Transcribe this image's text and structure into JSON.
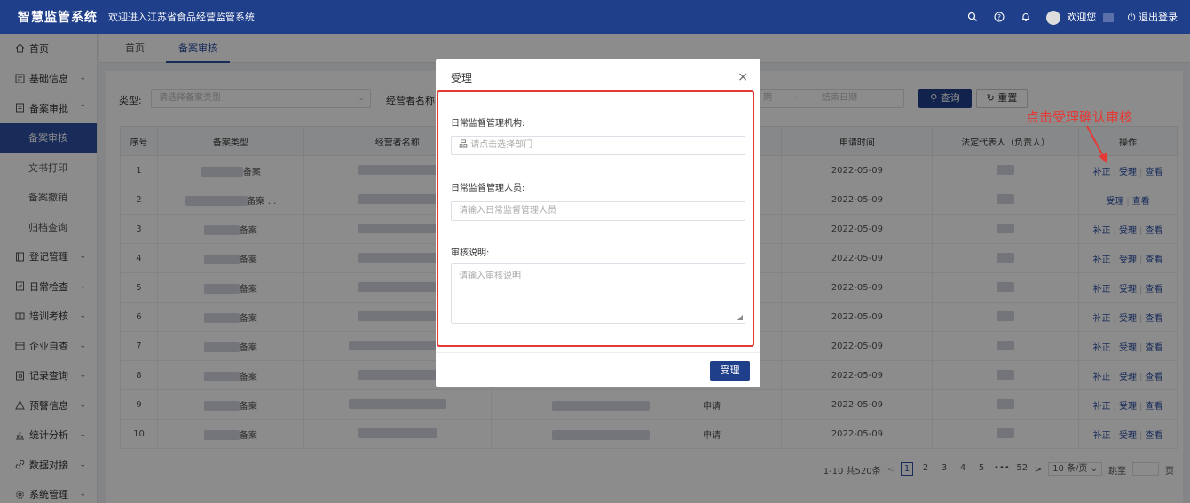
{
  "header": {
    "logo": "智慧监管系统",
    "welcome": "欢迎进入江苏省食品经营监管系统",
    "user_greeting": "欢迎您",
    "logout": "退出登录"
  },
  "sidebar": {
    "items": [
      {
        "label": "首页",
        "icon": "home-icon"
      },
      {
        "label": "基础信息",
        "icon": "info-icon",
        "chevron": "⌄"
      },
      {
        "label": "备案审批",
        "icon": "approval-icon",
        "chevron": "⌃"
      },
      {
        "label": "备案审核"
      },
      {
        "label": "文书打印"
      },
      {
        "label": "备案撤销"
      },
      {
        "label": "归档查询"
      },
      {
        "label": "登记管理",
        "icon": "register-icon",
        "chevron": "⌄"
      },
      {
        "label": "日常检查",
        "icon": "check-icon",
        "chevron": "⌄"
      },
      {
        "label": "培训考核",
        "icon": "training-icon",
        "chevron": "⌄"
      },
      {
        "label": "企业自查",
        "icon": "self-check-icon",
        "chevron": "⌄"
      },
      {
        "label": "记录查询",
        "icon": "record-icon",
        "chevron": "⌄"
      },
      {
        "label": "预警信息",
        "icon": "warning-icon",
        "chevron": "⌄"
      },
      {
        "label": "统计分析",
        "icon": "chart-icon",
        "chevron": "⌄"
      },
      {
        "label": "数据对接",
        "icon": "link-icon",
        "chevron": "⌄"
      },
      {
        "label": "系统管理",
        "icon": "settings-icon",
        "chevron": "⌄"
      }
    ]
  },
  "tabs": [
    {
      "label": "首页"
    },
    {
      "label": "备案审核"
    }
  ],
  "filters": {
    "type_label": "类型:",
    "type_placeholder": "请选择备案类型",
    "operator_label": "经营者名称:",
    "date_start_suffix": "期",
    "date_sep": "-",
    "date_end_placeholder": "结束日期",
    "search_btn": "查询",
    "reset_btn": "重置"
  },
  "table": {
    "headers": [
      "序号",
      "备案类型",
      "经营者名称",
      "",
      "申请时间",
      "法定代表人（负责人）",
      "操作"
    ],
    "rows": [
      {
        "no": "1",
        "type": "备案",
        "status": "",
        "date": "2022-05-09",
        "ops": [
          "补正",
          "受理",
          "查看"
        ]
      },
      {
        "no": "2",
        "type": "备案 ...",
        "status": "",
        "date": "2022-05-09",
        "ops": [
          "受理",
          "查看"
        ]
      },
      {
        "no": "3",
        "type": "备案",
        "status": "",
        "date": "2022-05-09",
        "ops": [
          "补正",
          "受理",
          "查看"
        ]
      },
      {
        "no": "4",
        "type": "备案",
        "status": "",
        "date": "2022-05-09",
        "ops": [
          "补正",
          "受理",
          "查看"
        ]
      },
      {
        "no": "5",
        "type": "备案",
        "status": "",
        "date": "2022-05-09",
        "ops": [
          "补正",
          "受理",
          "查看"
        ]
      },
      {
        "no": "6",
        "type": "备案",
        "status": "",
        "date": "2022-05-09",
        "ops": [
          "补正",
          "受理",
          "查看"
        ]
      },
      {
        "no": "7",
        "type": "备案",
        "status": "",
        "date": "2022-05-09",
        "ops": [
          "补正",
          "受理",
          "查看"
        ]
      },
      {
        "no": "8",
        "type": "备案",
        "status": "",
        "date": "2022-05-09",
        "ops": [
          "补正",
          "受理",
          "查看"
        ]
      },
      {
        "no": "9",
        "type": "备案",
        "status": "申请",
        "date": "2022-05-09",
        "ops": [
          "补正",
          "受理",
          "查看"
        ]
      },
      {
        "no": "10",
        "type": "备案",
        "status": "申请",
        "date": "2022-05-09",
        "ops": [
          "补正",
          "受理",
          "查看"
        ]
      }
    ]
  },
  "pager": {
    "summary": "1-10 共520条",
    "prev": "<",
    "pages": [
      "1",
      "2",
      "3",
      "4",
      "5",
      "•••",
      "52"
    ],
    "next": ">",
    "page_size": "10 条/页",
    "jump_label": "跳至",
    "page_suffix": "页"
  },
  "modal": {
    "title": "受理",
    "close": "×",
    "org_label": "日常监督管理机构:",
    "org_placeholder": "请点击选择部门",
    "person_label": "日常监督管理人员:",
    "person_placeholder": "请输入日常监督管理人员",
    "remark_label": "审核说明:",
    "remark_placeholder": "请输入审核说明",
    "submit": "受理"
  },
  "annotation": "点击受理确认审核",
  "colors": {
    "primary": "#1f3f8a",
    "accent": "#e53935"
  }
}
